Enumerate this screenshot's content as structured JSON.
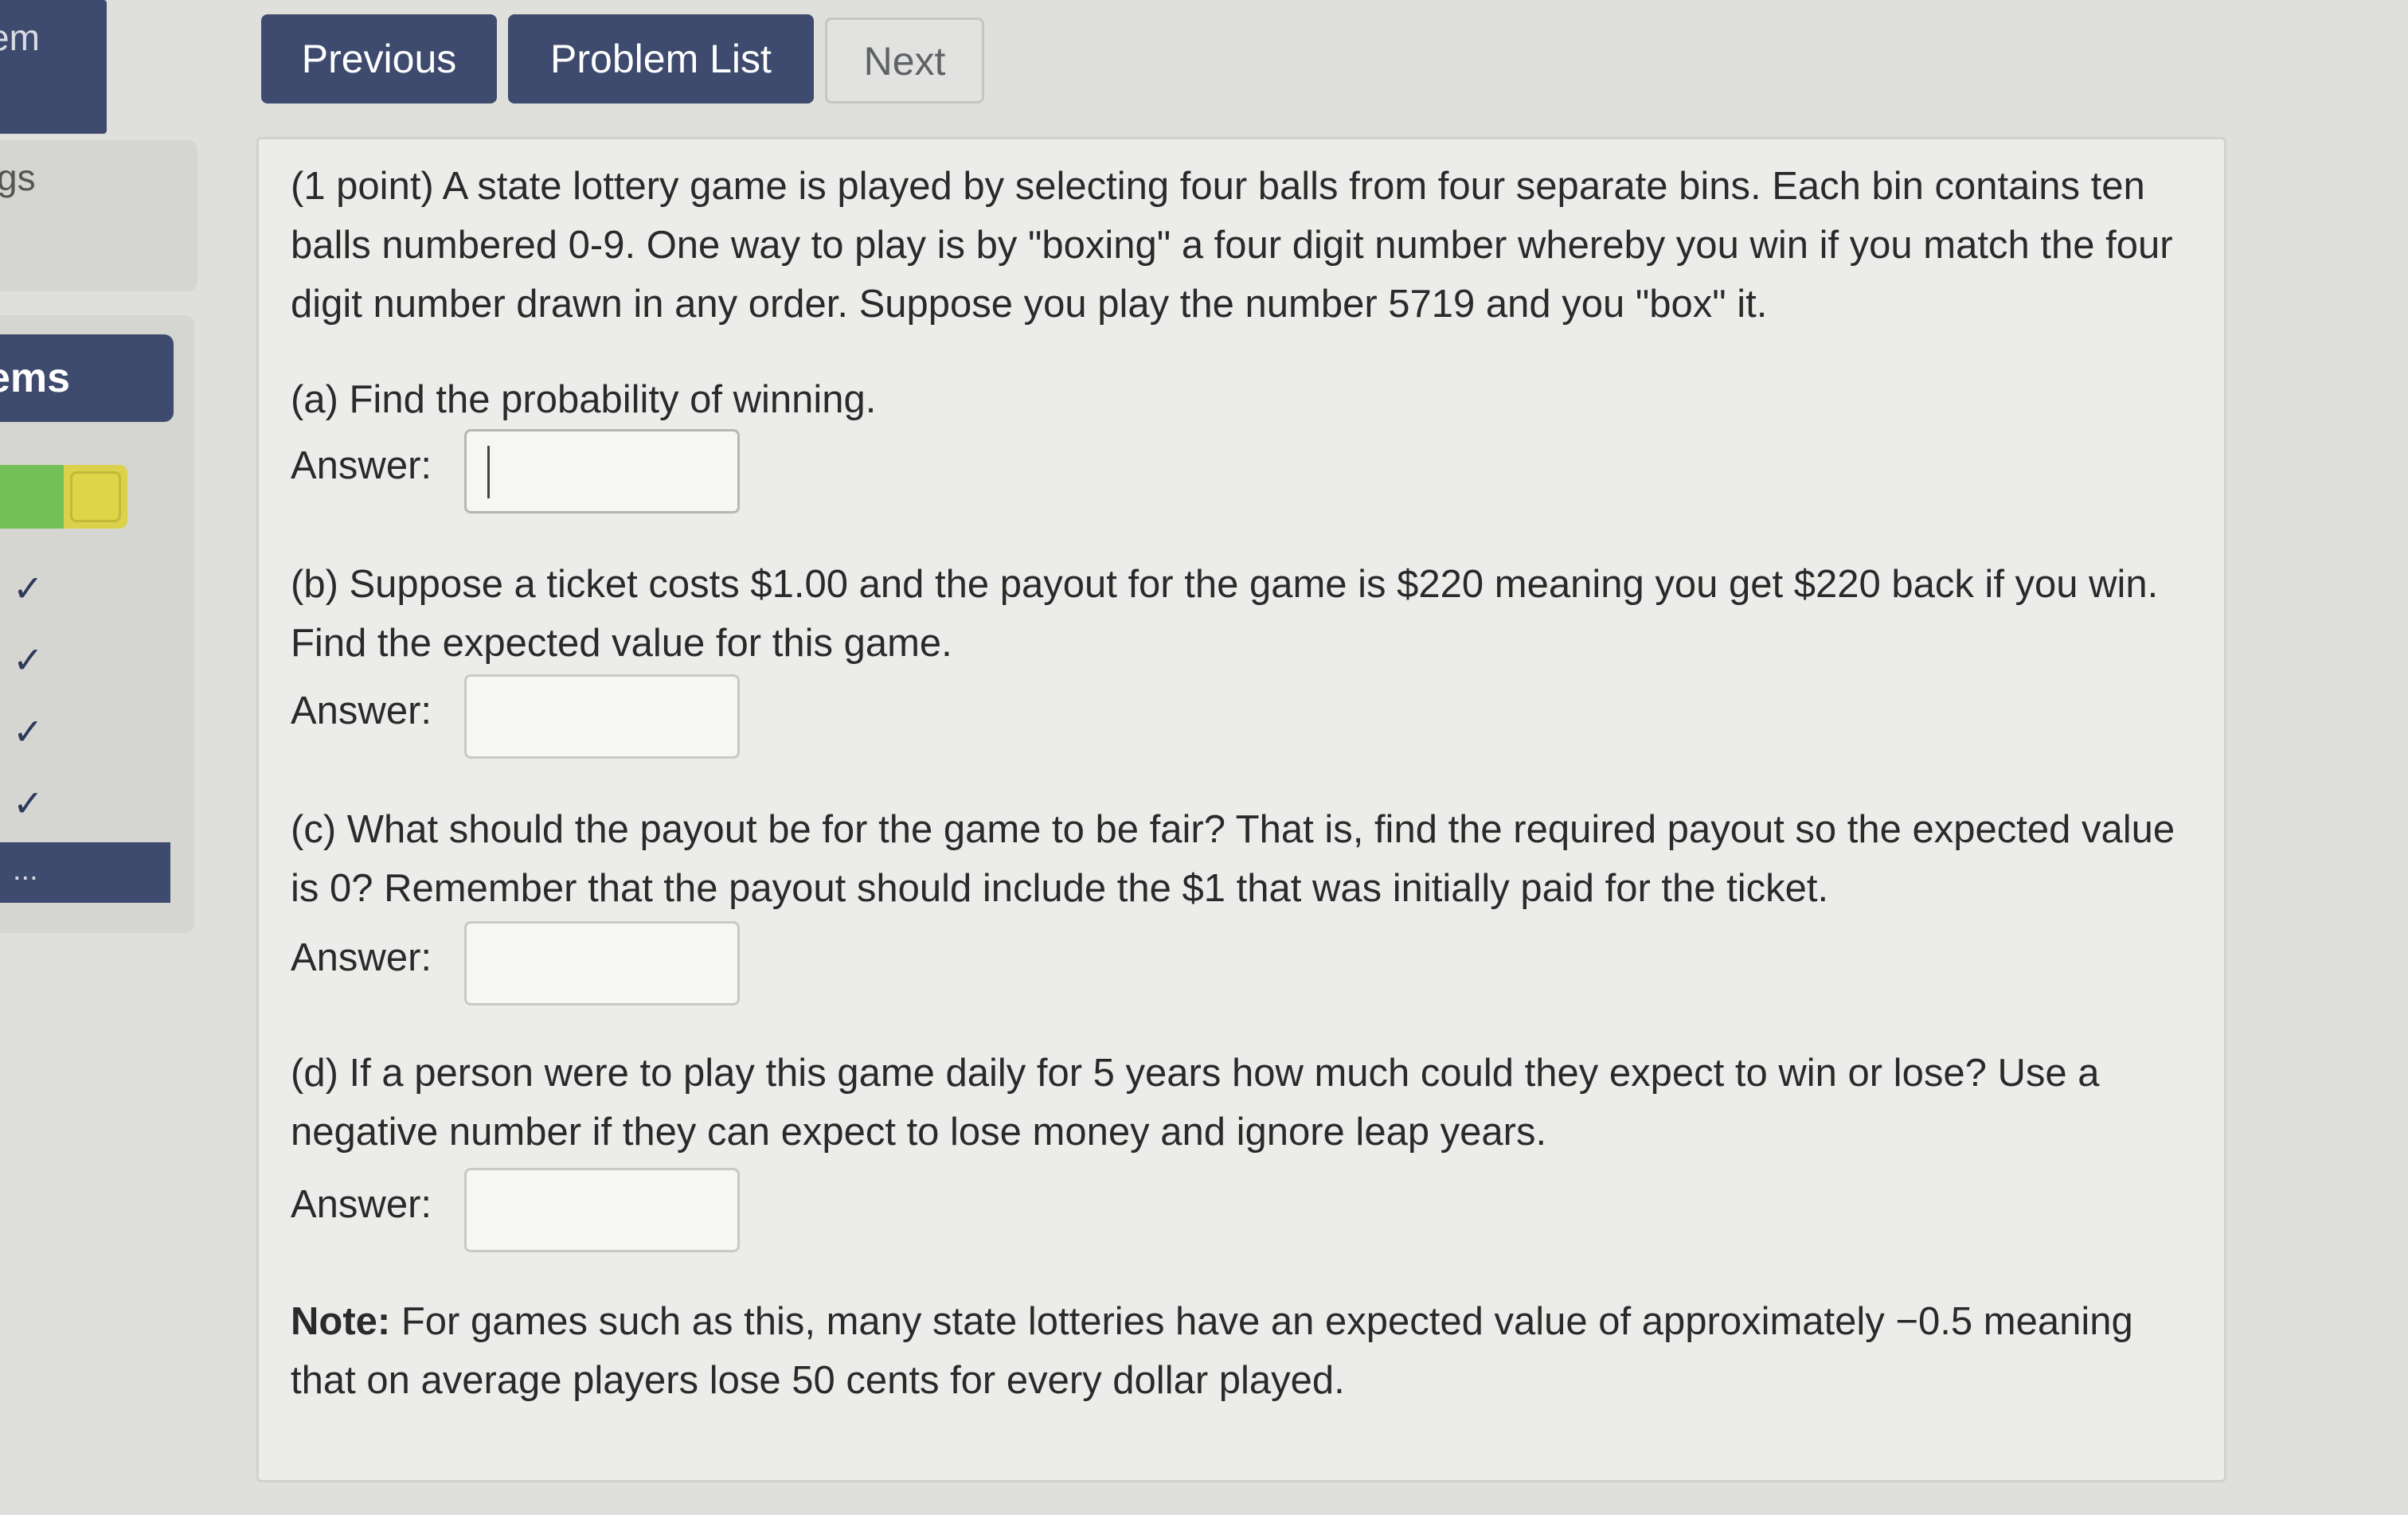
{
  "sidebar": {
    "top_label": "em",
    "section_label": "gs",
    "problems_label": "ems",
    "progress": {
      "complete_fraction": 0.5,
      "colors": {
        "done": "#74c257",
        "current": "#d9d24a"
      }
    },
    "checks": [
      "✓",
      "✓",
      "✓",
      "✓"
    ],
    "current_item": "..."
  },
  "nav": {
    "previous": "Previous",
    "problem_list": "Problem List",
    "next": "Next"
  },
  "problem": {
    "intro": "(1 point) A state lottery game is played by selecting four balls from four separate bins. Each bin contains ten balls numbered 0-9. One way to play is by \"boxing\" a four digit number whereby you win if you match the four digit number drawn in any order. Suppose you play the number 5719 and you \"box\" it.",
    "parts": [
      {
        "question": "(a) Find the probability of winning.",
        "answer_label": "Answer:",
        "value": ""
      },
      {
        "question": "(b) Suppose a ticket costs $1.00 and the payout for the game is $220 meaning you get $220 back if you win. Find the expected value for this game.",
        "answer_label": "Answer:",
        "value": ""
      },
      {
        "question": "(c) What should the payout be for the game to be fair? That is, find the required payout so the expected value is 0? Remember that the payout should include the $1 that was initially paid for the ticket.",
        "answer_label": "Answer:",
        "value": ""
      },
      {
        "question": "(d) If a person were to play this game daily for 5 years how much could they expect to win or lose? Use a negative number if they can expect to lose money and ignore leap years.",
        "answer_label": "Answer:",
        "value": ""
      }
    ],
    "note_label": "Note:",
    "note_text": " For games such as this, many state lotteries have an expected value of approximately −0.5 meaning that on average players lose 50 cents for every dollar played."
  }
}
